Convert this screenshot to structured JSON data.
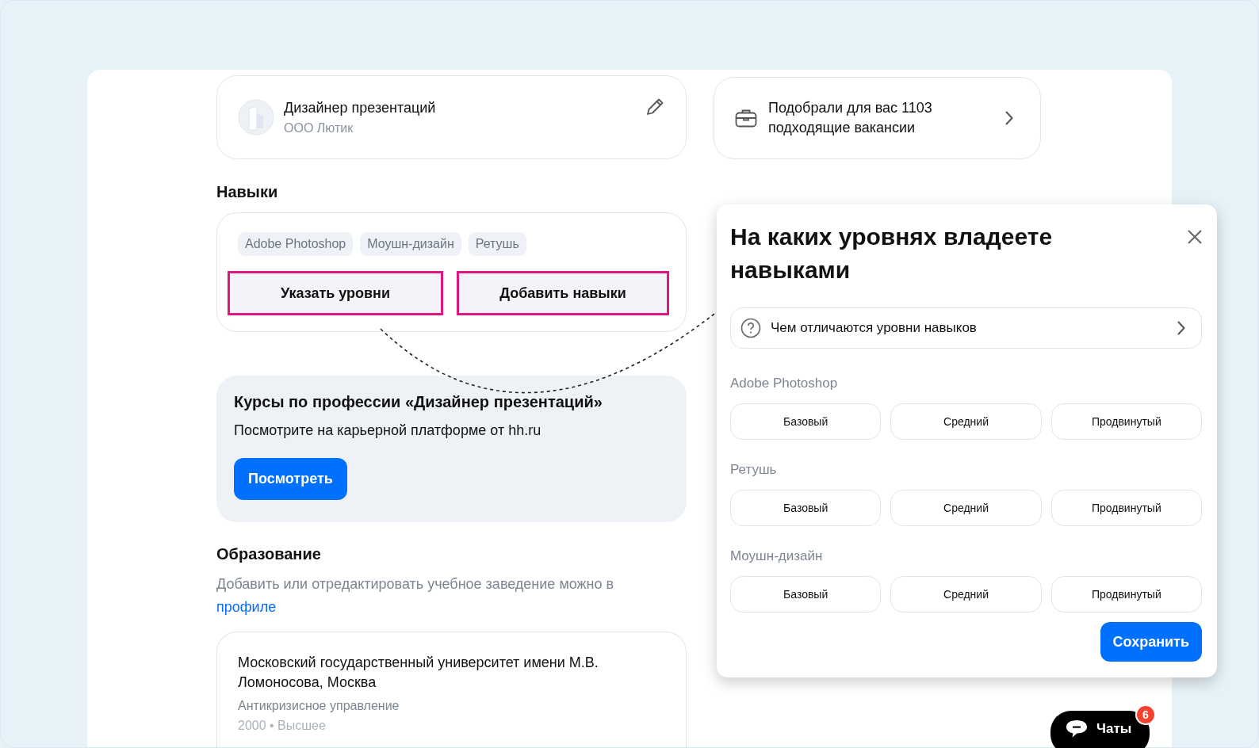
{
  "job_card": {
    "title": "Дизайнер презентаций",
    "company": "ООО Лютик"
  },
  "vacancies_card": {
    "text": "Подобрали для вас 1103 подходящие вакансии"
  },
  "skills": {
    "heading": "Навыки",
    "tags": [
      "Adobe Photoshop",
      "Моушн-дизайн",
      "Ретушь"
    ],
    "buttons": [
      {
        "label": "Указать уровни",
        "highlighted": true
      },
      {
        "label": "Добавить навыки",
        "highlighted": true
      }
    ]
  },
  "courses": {
    "title": "Курсы по профессии «Дизайнер презентаций»",
    "subtitle": "Посмотрите на карьерной платформе от hh.ru",
    "button": "Посмотреть"
  },
  "education": {
    "heading": "Образование",
    "note": "Добавить или отредактировать учебное заведение можно в",
    "link": "профиле",
    "items": [
      {
        "name": "Московский государственный университет имени М.В. Ломоносова, Москва",
        "faculty": "Антикризисное управление",
        "details": "2000 • Высшее"
      }
    ]
  },
  "modal": {
    "title": "На каких уровнях владеете навыками",
    "help_link": "Чем отличаются уровни навыков",
    "skills": [
      {
        "name": "Adobe Photoshop",
        "levels": [
          {
            "label": "Базовый",
            "selected": false
          },
          {
            "label": "Средний",
            "selected": false
          },
          {
            "label": "Продвинутый",
            "selected": false
          }
        ]
      },
      {
        "name": "Ретушь",
        "levels": [
          {
            "label": "Базовый",
            "selected": false
          },
          {
            "label": "Средний",
            "selected": false
          },
          {
            "label": "Продвинутый",
            "selected": false
          }
        ]
      },
      {
        "name": "Моушн-дизайн",
        "levels": [
          {
            "label": "Базовый",
            "selected": false
          },
          {
            "label": "Средний",
            "selected": false
          },
          {
            "label": "Продвинутый",
            "selected": false
          }
        ]
      }
    ],
    "save_button": "Сохранить"
  },
  "chats": {
    "label": "Чаты",
    "badge": "6"
  }
}
